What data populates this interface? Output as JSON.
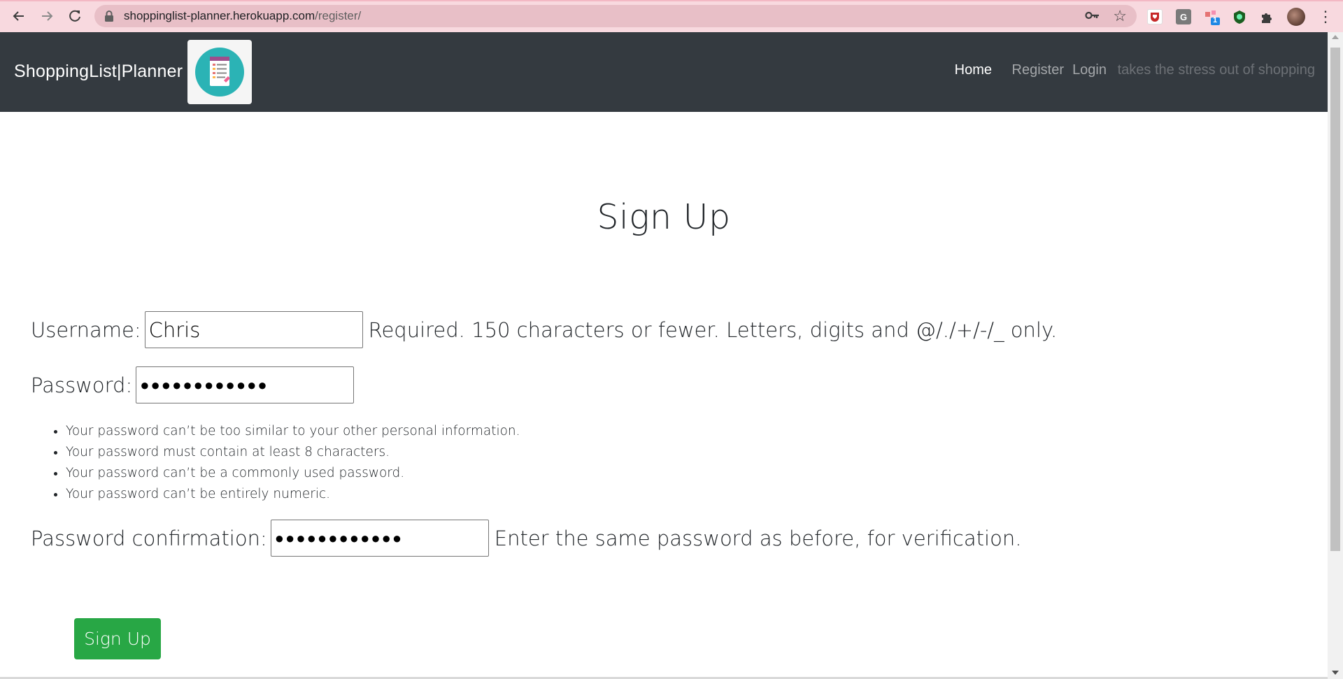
{
  "browser": {
    "url_host": "shoppinglist-planner.herokuapp.com",
    "url_path": "/register/",
    "extension_badge": "1",
    "extension_g_label": "G",
    "icons": [
      "back-icon",
      "forward-icon",
      "reload-icon",
      "lock-icon",
      "key-icon",
      "star-icon",
      "puzzle-icon",
      "kebab-menu-icon"
    ]
  },
  "navbar": {
    "brand": "ShoppingList|Planner",
    "links": [
      {
        "label": "Home",
        "active": true
      },
      {
        "label": "Register",
        "active": false
      },
      {
        "label": "Login",
        "active": false
      }
    ],
    "tagline": "takes the stress out of shopping",
    "background": "#343a40"
  },
  "page": {
    "title": "Sign Up"
  },
  "form": {
    "username": {
      "label": "Username:",
      "value": "Chris",
      "help": "Required. 150 characters or fewer. Letters, digits and @/./+/-/_ only."
    },
    "password": {
      "label": "Password:",
      "value": "●●●●●●●●●●●●"
    },
    "password_rules": [
      "Your password can’t be too similar to your other personal information.",
      "Your password must contain at least 8 characters.",
      "Your password can’t be a commonly used password.",
      "Your password can’t be entirely numeric."
    ],
    "password_confirmation": {
      "label": "Password confirmation:",
      "value": "●●●●●●●●●●●●",
      "help": "Enter the same password as before, for verification."
    },
    "submit_label": "Sign Up",
    "submit_color": "#28a745"
  }
}
